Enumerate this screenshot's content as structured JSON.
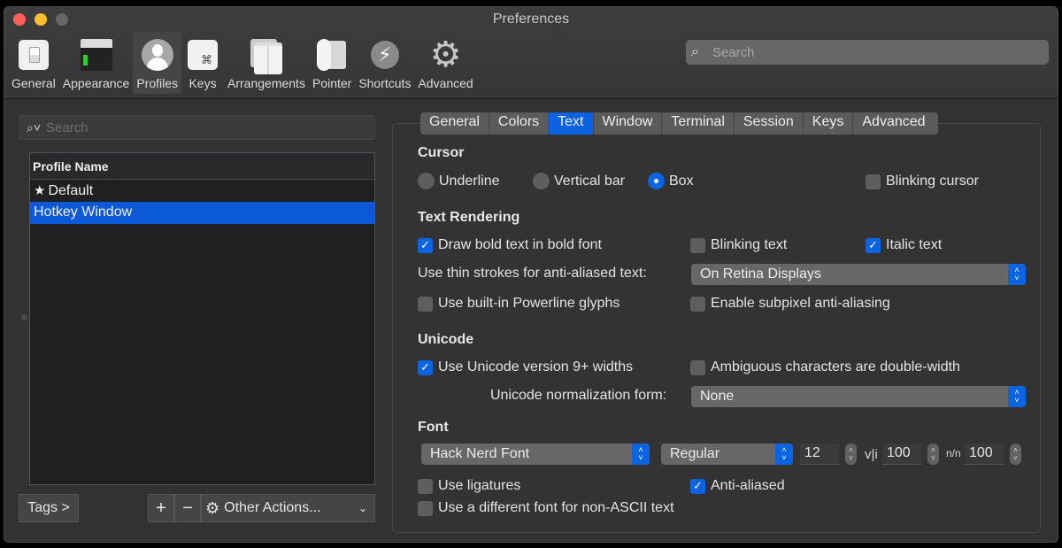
{
  "window": {
    "title": "Preferences"
  },
  "toolbar": {
    "items": [
      {
        "label": "General",
        "icon": "general-switch-icon"
      },
      {
        "label": "Appearance",
        "icon": "appearance-window-icon"
      },
      {
        "label": "Profiles",
        "icon": "profile-user-icon",
        "active": true
      },
      {
        "label": "Keys",
        "icon": "command-key-icon",
        "glyph": "⌘"
      },
      {
        "label": "Arrangements",
        "icon": "arrangements-windows-icon"
      },
      {
        "label": "Pointer",
        "icon": "mouse-pointer-icon"
      },
      {
        "label": "Shortcuts",
        "icon": "lightning-icon",
        "glyph": "⚡"
      },
      {
        "label": "Advanced",
        "icon": "gear-icon",
        "glyph": "⚙"
      }
    ],
    "search_placeholder": "Search",
    "search_glyph": "⌕"
  },
  "profiles": {
    "search_placeholder": "Search",
    "search_glyph": "⌕˅",
    "column_header": "Profile Name",
    "rows": [
      {
        "name": "Default",
        "default": true,
        "star": "★"
      },
      {
        "name": "Hotkey Window",
        "selected": true
      }
    ],
    "tags_button": "Tags >",
    "add_button": "+",
    "remove_button": "−",
    "other_actions_button": "Other Actions...",
    "gear_glyph": "⚙",
    "chevron_glyph": "⌄"
  },
  "tabs": {
    "items": [
      "General",
      "Colors",
      "Text",
      "Window",
      "Terminal",
      "Session",
      "Keys",
      "Advanced"
    ],
    "active": "Text"
  },
  "cursor": {
    "heading": "Cursor",
    "options": [
      "Underline",
      "Vertical bar",
      "Box"
    ],
    "selected": "Box",
    "blinking_label": "Blinking cursor",
    "blinking": false
  },
  "text_rendering": {
    "heading": "Text Rendering",
    "bold_label": "Draw bold text in bold font",
    "bold": true,
    "blinking_text_label": "Blinking text",
    "blinking_text": false,
    "italic_label": "Italic text",
    "italic": true,
    "thin_strokes_label": "Use thin strokes for anti-aliased text:",
    "thin_strokes_value": "On Retina Displays",
    "powerline_label": "Use built-in Powerline glyphs",
    "powerline": false,
    "subpixel_label": "Enable subpixel anti-aliasing",
    "subpixel": false
  },
  "unicode": {
    "heading": "Unicode",
    "v9_label": "Use Unicode version 9+ widths",
    "v9": true,
    "ambiguous_label": "Ambiguous characters are double-width",
    "ambiguous": false,
    "normalization_label": "Unicode normalization form:",
    "normalization_value": "None"
  },
  "font": {
    "heading": "Font",
    "family": "Hack Nerd Font",
    "style": "Regular",
    "size": "12",
    "h_spacing_glyph": "v|i",
    "h_spacing": "100",
    "v_spacing_glyph": "n/n",
    "v_spacing": "100",
    "ligatures_label": "Use ligatures",
    "ligatures": false,
    "antialiased_label": "Anti-aliased",
    "antialiased": true,
    "non_ascii_label": "Use a different font for non-ASCII text",
    "non_ascii": false
  },
  "glyphs": {
    "check": "✓",
    "up": "˄",
    "down": "˅"
  },
  "colors": {
    "accent": "#0b64e0",
    "selection": "#0b59d6",
    "window_bg": "#323233"
  }
}
